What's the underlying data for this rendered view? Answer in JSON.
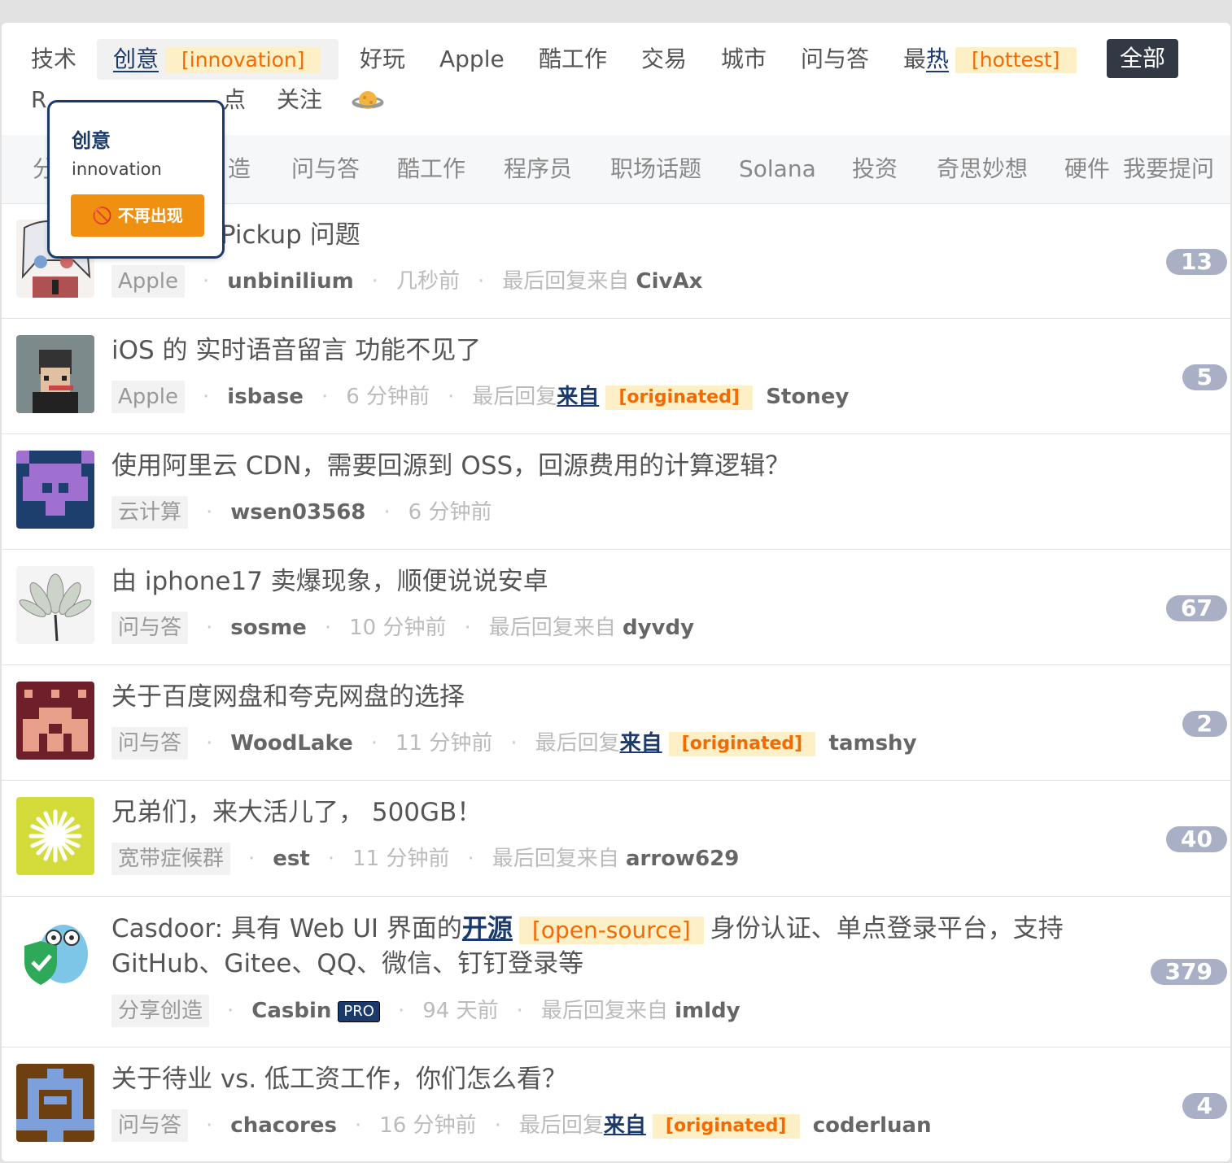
{
  "tabs": {
    "row1": [
      "技术",
      "创意",
      "好玩",
      "Apple",
      "酷工作",
      "交易",
      "城市",
      "问与答",
      "最热",
      "全部"
    ],
    "row2": [
      "R",
      "点",
      "关注"
    ],
    "innovation_tag": "[innovation]",
    "hottest_prefix": "最",
    "hottest_underlined": "热",
    "hottest_tag": "[hottest]"
  },
  "subtabs": [
    "分",
    "造",
    "问与答",
    "酷工作",
    "程序员",
    "职场话题",
    "Solana",
    "投资",
    "奇思妙想",
    "硬件",
    "我要提问"
  ],
  "popup": {
    "title": "创意",
    "subtitle": "innovation",
    "button": "不再出现"
  },
  "topics": [
    {
      "title": "香港官网 Pickup 问题",
      "node": "Apple",
      "user": "unbinilium",
      "time": "几秒前",
      "last_prefix": "最后回复来自",
      "last_user": "CivAx",
      "replies": "13"
    },
    {
      "title": "iOS 的 实时语音留言 功能不见了",
      "node": "Apple",
      "user": "isbase",
      "time": "6 分钟前",
      "last_prefix": "最后回复",
      "last_link": "来自",
      "last_tag": "[originated]",
      "last_user": "Stoney",
      "replies": "5"
    },
    {
      "title": "使用阿里云 CDN，需要回源到 OSS，回源费用的计算逻辑？",
      "node": "云计算",
      "user": "wsen03568",
      "time": "6 分钟前"
    },
    {
      "title": "由 iphone17 卖爆现象，顺便说说安卓",
      "node": "问与答",
      "user": "sosme",
      "time": "10 分钟前",
      "last_prefix": "最后回复来自",
      "last_user": "dyvdy",
      "replies": "67"
    },
    {
      "title": "关于百度网盘和夸克网盘的选择",
      "node": "问与答",
      "user": "WoodLake",
      "time": "11 分钟前",
      "last_prefix": "最后回复",
      "last_link": "来自",
      "last_tag": "[originated]",
      "last_user": "tamshy",
      "replies": "2"
    },
    {
      "title": "兄弟们，来大活儿了， 500GB！",
      "node": "宽带症候群",
      "user": "est",
      "time": "11 分钟前",
      "last_prefix": "最后回复来自",
      "last_user": "arrow629",
      "replies": "40"
    },
    {
      "title_pre": "Casdoor: 具有 Web UI 界面的",
      "title_link": "开源",
      "title_tag": "[open-source]",
      "title_post": "身份认证、单点登录平台，支持",
      "title_line2": "GitHub、Gitee、QQ、微信、钉钉登录等",
      "node": "分享创造",
      "user": "Casbin",
      "pro": "PRO",
      "time": "94 天前",
      "last_prefix": "最后回复来自",
      "last_user": "imldy",
      "replies": "379"
    },
    {
      "title": "关于待业 vs. 低工资工作，你们怎么看？",
      "node": "问与答",
      "user": "chacores",
      "time": "16 分钟前",
      "last_prefix": "最后回复",
      "last_link": "来自",
      "last_tag": "[originated]",
      "last_user": "coderluan",
      "replies": "4"
    }
  ],
  "dot": "·"
}
